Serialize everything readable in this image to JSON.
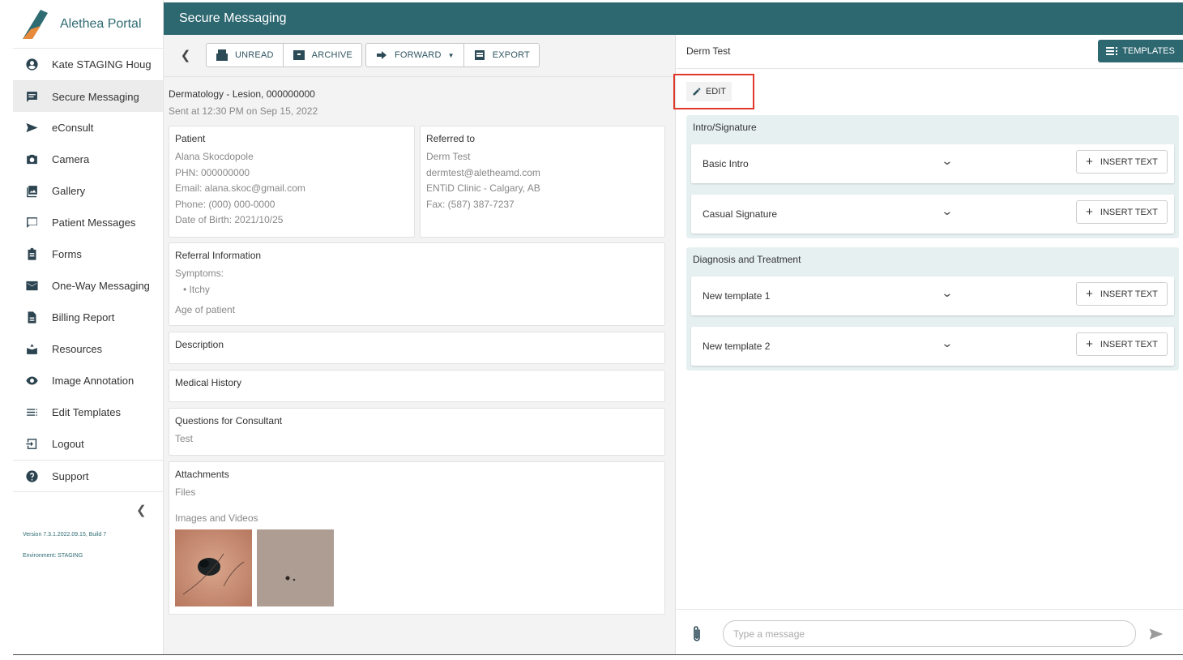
{
  "app": {
    "brand": "Alethea Portal",
    "page_title": "Secure Messaging"
  },
  "sidebar": {
    "items": [
      {
        "label": "Kate STAGING Houg",
        "icon": "account-circle-icon"
      },
      {
        "label": "Secure Messaging",
        "icon": "chat-icon",
        "active": true
      },
      {
        "label": "eConsult",
        "icon": "send-icon"
      },
      {
        "label": "Camera",
        "icon": "camera-icon"
      },
      {
        "label": "Gallery",
        "icon": "gallery-icon"
      },
      {
        "label": "Patient Messages",
        "icon": "message-box-icon"
      },
      {
        "label": "Forms",
        "icon": "clipboard-icon"
      },
      {
        "label": "One-Way Messaging",
        "icon": "mail-icon"
      },
      {
        "label": "Billing Report",
        "icon": "document-icon"
      },
      {
        "label": "Resources",
        "icon": "resources-icon"
      },
      {
        "label": "Image Annotation",
        "icon": "eye-icon"
      },
      {
        "label": "Edit Templates",
        "icon": "list-icon"
      },
      {
        "label": "Logout",
        "icon": "logout-icon"
      },
      {
        "label": "Support",
        "icon": "help-icon"
      }
    ],
    "version": "Version 7.3.1.2022.09.15, Build 7",
    "environment": "Environment: STAGING"
  },
  "toolbar": {
    "unread": "UNREAD",
    "archive": "ARCHIVE",
    "forward": "FORWARD",
    "export": "EXPORT"
  },
  "message": {
    "title": "Dermatology - Lesion, 000000000",
    "sent": "Sent at 12:30 PM on Sep 15, 2022",
    "patient": {
      "header": "Patient",
      "name": "Alana Skocdopole",
      "phn": "PHN: 000000000",
      "email": "Email: alana.skoc@gmail.com",
      "phone": "Phone: (000) 000-0000",
      "dob": "Date of Birth: 2021/10/25"
    },
    "referred": {
      "header": "Referred to",
      "name": "Derm Test",
      "email": "dermtest@aletheamd.com",
      "clinic": "ENTiD Clinic - Calgary, AB",
      "fax": "Fax: (587) 387-7237"
    },
    "referral_info": {
      "header": "Referral Information",
      "symptoms_label": "Symptoms:",
      "symptom": "• Itchy",
      "age_label": "Age of patient"
    },
    "description": "Description",
    "medical_history": "Medical History",
    "questions": {
      "header": "Questions for Consultant",
      "value": "Test"
    },
    "attachments": {
      "header": "Attachments",
      "files": "Files",
      "images": "Images and Videos"
    }
  },
  "right": {
    "recipient": "Derm Test",
    "templates_btn": "TEMPLATES",
    "edit_btn": "EDIT",
    "sections": [
      {
        "title": "Intro/Signature",
        "templates": [
          "Basic Intro",
          "Casual Signature"
        ]
      },
      {
        "title": "Diagnosis and Treatment",
        "templates": [
          "New template 1",
          "New template 2"
        ]
      }
    ],
    "insert_label": "INSERT TEXT",
    "compose_placeholder": "Type a message"
  },
  "colors": {
    "brand_teal": "#2d6770",
    "section_bg": "#e6f0f1",
    "highlight_red": "#e0392b"
  }
}
